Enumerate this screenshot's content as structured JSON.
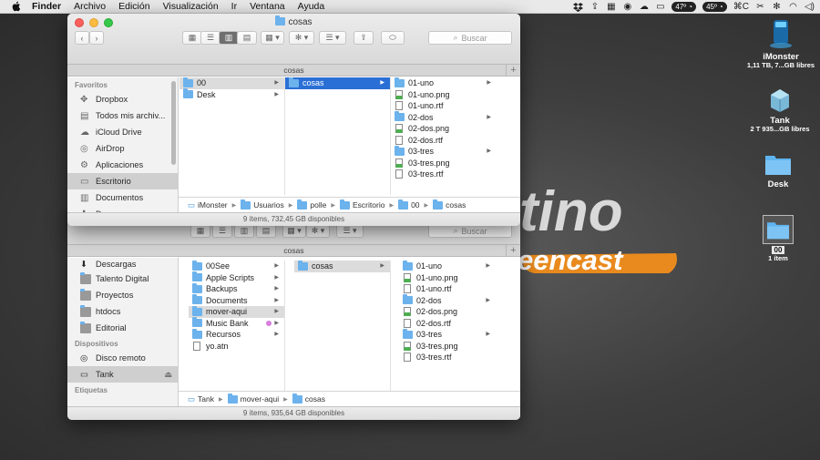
{
  "menubar": {
    "app": "Finder",
    "items": [
      "Archivo",
      "Edición",
      "Visualización",
      "Ir",
      "Ventana",
      "Ayuda"
    ],
    "temp1": "47º",
    "temp2": "45º",
    "shortcut": "⌘C"
  },
  "wallpaper": {
    "text1": "tino",
    "text2": "eencast"
  },
  "desktop": [
    {
      "name": "iMonster",
      "sub": "1,11 TB, 7...GB libres",
      "icon": "hard-drive-icon"
    },
    {
      "name": "Tank",
      "sub": "2 T  935...GB libres",
      "icon": "hard-drive-icon"
    },
    {
      "name": "Desk",
      "sub": "",
      "icon": "folder-icon"
    },
    {
      "name": "00",
      "sub": "1 ítem",
      "icon": "folder-icon"
    }
  ],
  "window1": {
    "title": "cosas",
    "tab": "cosas",
    "search": "Buscar",
    "sidebar_header": "Favoritos",
    "sidebar": [
      {
        "label": "Dropbox",
        "icon": "dropbox-icon"
      },
      {
        "label": "Todos mis archiv...",
        "icon": "all-files-icon"
      },
      {
        "label": "iCloud Drive",
        "icon": "cloud-icon"
      },
      {
        "label": "AirDrop",
        "icon": "airdrop-icon"
      },
      {
        "label": "Aplicaciones",
        "icon": "applications-icon"
      },
      {
        "label": "Escritorio",
        "icon": "desktop-icon"
      },
      {
        "label": "Documentos",
        "icon": "documents-icon"
      },
      {
        "label": "Descargas",
        "icon": "downloads-icon"
      }
    ],
    "col1": [
      "00",
      "Desk"
    ],
    "col2": [
      "cosas"
    ],
    "col3": [
      {
        "name": "01-uno",
        "type": "folder"
      },
      {
        "name": "01-uno.png",
        "type": "png"
      },
      {
        "name": "01-uno.rtf",
        "type": "rtf"
      },
      {
        "name": "02-dos",
        "type": "folder"
      },
      {
        "name": "02-dos.png",
        "type": "png"
      },
      {
        "name": "02-dos.rtf",
        "type": "rtf"
      },
      {
        "name": "03-tres",
        "type": "folder"
      },
      {
        "name": "03-tres.png",
        "type": "png"
      },
      {
        "name": "03-tres.rtf",
        "type": "rtf"
      }
    ],
    "path": [
      "iMonster",
      "Usuarios",
      "polle",
      "Escritorio",
      "00",
      "cosas"
    ],
    "status": "9 ítems, 732,45 GB disponibles"
  },
  "window2": {
    "tab": "cosas",
    "search": "Buscar",
    "sidebar": [
      {
        "label": "Descargas",
        "icon": "downloads-icon"
      },
      {
        "label": "Talento Digital",
        "icon": "folder-icon"
      },
      {
        "label": "Proyectos",
        "icon": "folder-icon"
      },
      {
        "label": "htdocs",
        "icon": "folder-icon"
      },
      {
        "label": "Editorial",
        "icon": "folder-icon"
      }
    ],
    "devices_header": "Dispositivos",
    "devices": [
      {
        "label": "Disco remoto",
        "icon": "remote-disc-icon"
      },
      {
        "label": "Tank",
        "icon": "hard-drive-icon"
      }
    ],
    "tags_header": "Etiquetas",
    "col1": [
      {
        "name": "00See",
        "arrow": true
      },
      {
        "name": "Apple Scripts",
        "arrow": true
      },
      {
        "name": "Backups",
        "arrow": true
      },
      {
        "name": "Documents",
        "arrow": true
      },
      {
        "name": "mover-aqui",
        "arrow": true
      },
      {
        "name": "Music Bank",
        "arrow": true
      },
      {
        "name": "Recursos",
        "arrow": true
      },
      {
        "name": "yo.atn",
        "arrow": false
      }
    ],
    "col2": [
      "cosas"
    ],
    "col3": [
      {
        "name": "01-uno",
        "type": "folder"
      },
      {
        "name": "01-uno.png",
        "type": "png"
      },
      {
        "name": "01-uno.rtf",
        "type": "rtf"
      },
      {
        "name": "02-dos",
        "type": "folder"
      },
      {
        "name": "02-dos.png",
        "type": "png"
      },
      {
        "name": "02-dos.rtf",
        "type": "rtf"
      },
      {
        "name": "03-tres",
        "type": "folder"
      },
      {
        "name": "03-tres.png",
        "type": "png"
      },
      {
        "name": "03-tres.rtf",
        "type": "rtf"
      }
    ],
    "path": [
      "Tank",
      "mover-aqui",
      "cosas"
    ],
    "status": "9 ítems, 935,64 GB disponibles"
  },
  "colors": {
    "selection": "#2a6fd5",
    "folder": "#6cb2ec",
    "wallpaper_orange": "#e98a1e"
  }
}
